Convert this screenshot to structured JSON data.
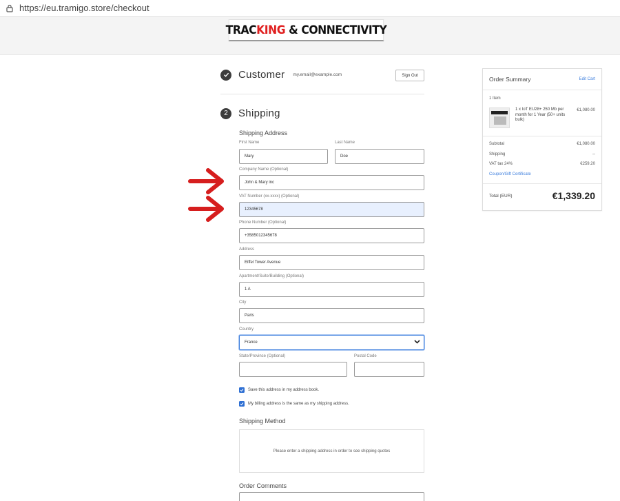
{
  "browser": {
    "url": "https://eu.tramigo.store/checkout",
    "lock_icon": "lock-icon"
  },
  "header": {
    "logo_part1": "TRAC",
    "logo_part2": "KING",
    "logo_part3": " & CONNECTIVITY",
    "accent_color": "#e02020"
  },
  "customer": {
    "step_title": "Customer",
    "email": "my.email@example.com",
    "sign_out_label": "Sign Out"
  },
  "shipping": {
    "step_number": "2",
    "step_title": "Shipping",
    "address_heading": "Shipping Address",
    "first_name": {
      "label": "First Name",
      "value": "Mary"
    },
    "last_name": {
      "label": "Last Name",
      "value": "Doe"
    },
    "company": {
      "label": "Company Name (Optional)",
      "value": "John & Mary inc"
    },
    "vat": {
      "label": "VAT Number (xx-xxxx) (Optional)",
      "value": "12345678"
    },
    "phone": {
      "label": "Phone Number (Optional)",
      "value": "+3585012345678"
    },
    "address": {
      "label": "Address",
      "value": "Eiffel Tower Avenue"
    },
    "apartment": {
      "label": "Apartment/Suite/Building (Optional)",
      "value": "1 A"
    },
    "city": {
      "label": "City",
      "value": "Paris"
    },
    "country": {
      "label": "Country",
      "value": "France"
    },
    "state": {
      "label": "State/Province (Optional)",
      "value": ""
    },
    "postal": {
      "label": "Postal Code",
      "value": ""
    },
    "save_address_label": "Save this address in my address book.",
    "billing_same_label": "My billing address is the same as my shipping address.",
    "method_heading": "Shipping Method",
    "method_placeholder": "Please enter a shipping address in order to see shipping quotes",
    "comments_heading": "Order Comments"
  },
  "summary": {
    "title": "Order Summary",
    "edit_cart": "Edit Cart",
    "item_count": "1 Item",
    "item_desc": "1 x IoT EU28+ 250 Mb per month for 1 Year (50+ units bulk)",
    "item_price": "€1,080.00",
    "subtotal_label": "Subtotal",
    "subtotal_value": "€1,080.00",
    "shipping_label": "Shipping",
    "shipping_value": "--",
    "vat_label": "VAT tax 24%",
    "vat_value": "€259.20",
    "coupon_link": "Coupon/Gift Certificate",
    "total_label": "Total (EUR)",
    "total_value": "€1,339.20",
    "link_color": "#3b7ddd"
  },
  "annotation_color": "#d61e1e"
}
